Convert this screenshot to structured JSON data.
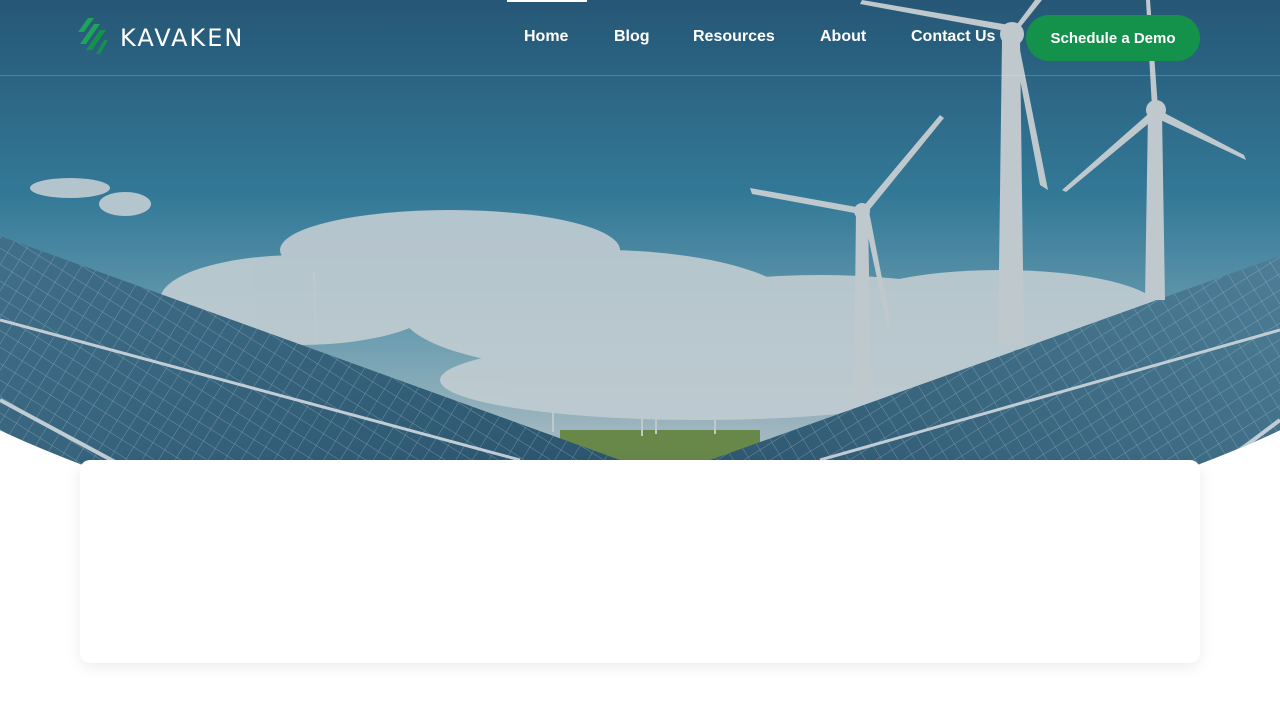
{
  "brand": {
    "name": "KAVAKEN",
    "logo_icon": "stripes-logo-icon",
    "accent": "#14924b"
  },
  "nav": {
    "items": [
      {
        "label": "Home",
        "active": true
      },
      {
        "label": "Blog",
        "active": false
      },
      {
        "label": "Resources",
        "active": false
      },
      {
        "label": "About",
        "active": false
      },
      {
        "label": "Contact Us",
        "active": false
      }
    ]
  },
  "cta": {
    "label": "Schedule a Demo",
    "color": "#14924b"
  },
  "hero": {
    "image": "solar-panels-and-wind-turbines"
  }
}
